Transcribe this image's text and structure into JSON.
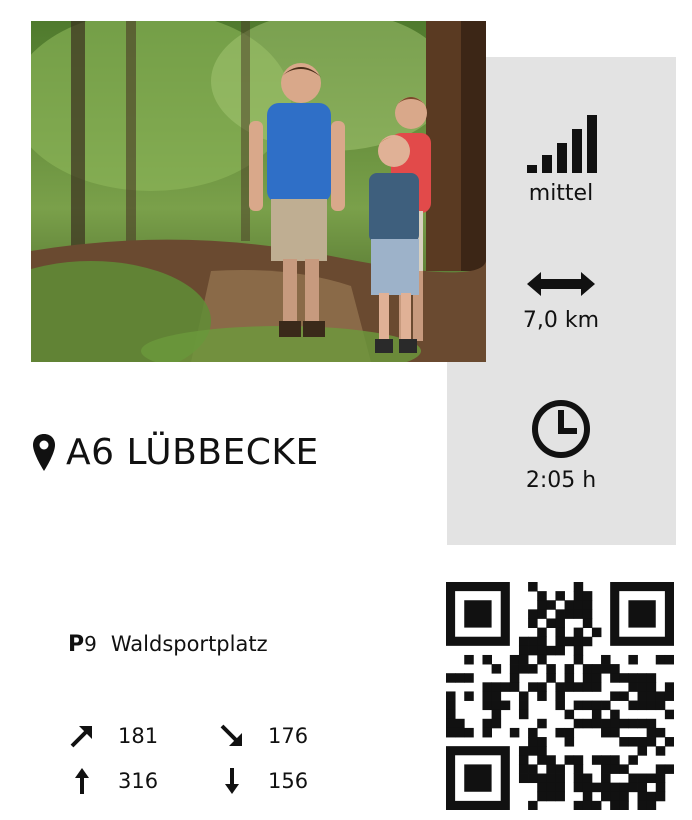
{
  "route": {
    "title": "A6 LÜBBECKE",
    "stats": {
      "difficulty_label": "mittel",
      "distance_label": "7,0 km",
      "duration_label": "2:05 h"
    },
    "parking": {
      "badge": "P",
      "number": "9",
      "name": "Waldsportplatz"
    },
    "elevation": {
      "ascent": "181",
      "descent": "176",
      "max": "316",
      "min": "156"
    }
  },
  "colors": {
    "panel": "#e3e3e3",
    "text": "#111111"
  },
  "icons": {
    "difficulty": "signal-bars-icon",
    "distance": "double-arrow-icon",
    "duration": "clock-icon",
    "location": "map-pin-icon",
    "ascent": "arrow-up-right-icon",
    "descent": "arrow-down-right-icon",
    "max": "arrow-up-icon",
    "min": "arrow-down-icon",
    "qr": "qr-code"
  }
}
